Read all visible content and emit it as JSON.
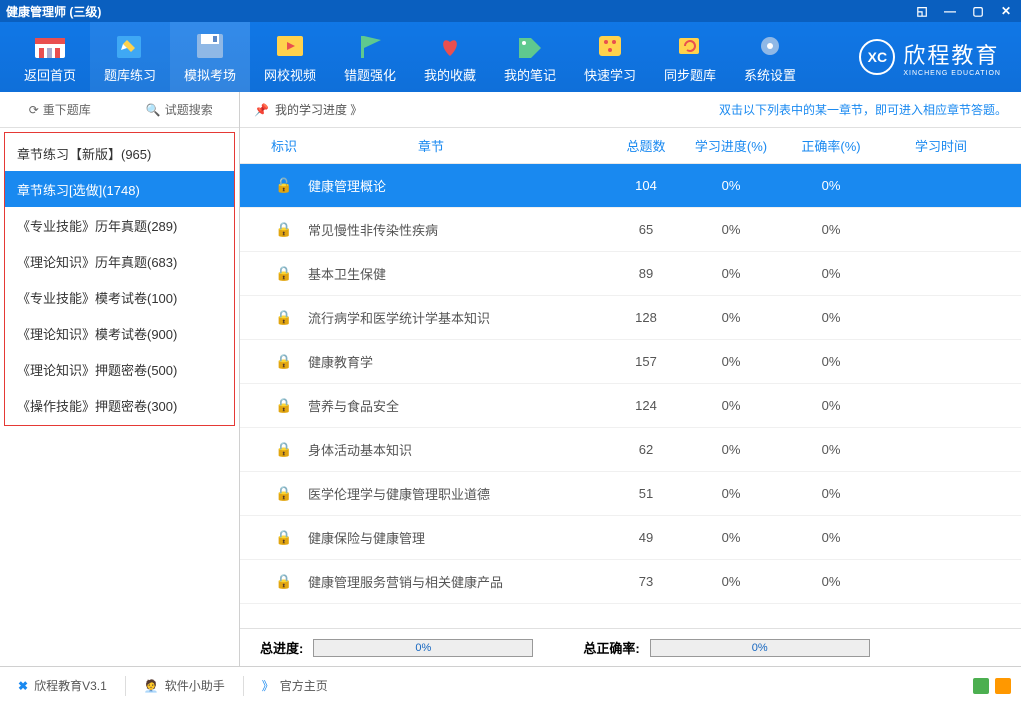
{
  "window": {
    "title": "健康管理师 (三级)"
  },
  "toolbar": [
    {
      "label": "返回首页"
    },
    {
      "label": "题库练习"
    },
    {
      "label": "模拟考场"
    },
    {
      "label": "网校视频"
    },
    {
      "label": "错题强化"
    },
    {
      "label": "我的收藏"
    },
    {
      "label": "我的笔记"
    },
    {
      "label": "快速学习"
    },
    {
      "label": "同步题库"
    },
    {
      "label": "系统设置"
    }
  ],
  "brand": {
    "abbr": "XC",
    "name": "欣程教育",
    "sub": "XINCHENG EDUCATION"
  },
  "sidebar": {
    "refresh": "重下题库",
    "search": "试题搜索",
    "items": [
      "章节练习【新版】(965)",
      "章节练习[选做](1748)",
      "《专业技能》历年真题(289)",
      "《理论知识》历年真题(683)",
      "《专业技能》模考试卷(100)",
      "《理论知识》模考试卷(900)",
      "《理论知识》押题密卷(500)",
      "《操作技能》押题密卷(300)"
    ]
  },
  "hintbar": {
    "left": "我的学习进度 》",
    "right": "双击以下列表中的某一章节，即可进入相应章节答题。"
  },
  "columns": {
    "flag": "标识",
    "chapter": "章节",
    "total": "总题数",
    "progress": "学习进度(%)",
    "accuracy": "正确率(%)",
    "time": "学习时间"
  },
  "rows": [
    {
      "title": "健康管理概论",
      "total": "104",
      "progress": "0%",
      "accuracy": "0%"
    },
    {
      "title": "常见慢性非传染性疾病",
      "total": "65",
      "progress": "0%",
      "accuracy": "0%"
    },
    {
      "title": "基本卫生保健",
      "total": "89",
      "progress": "0%",
      "accuracy": "0%"
    },
    {
      "title": "流行病学和医学统计学基本知识",
      "total": "128",
      "progress": "0%",
      "accuracy": "0%"
    },
    {
      "title": "健康教育学",
      "total": "157",
      "progress": "0%",
      "accuracy": "0%"
    },
    {
      "title": "营养与食品安全",
      "total": "124",
      "progress": "0%",
      "accuracy": "0%"
    },
    {
      "title": "身体活动基本知识",
      "total": "62",
      "progress": "0%",
      "accuracy": "0%"
    },
    {
      "title": "医学伦理学与健康管理职业道德",
      "total": "51",
      "progress": "0%",
      "accuracy": "0%"
    },
    {
      "title": "健康保险与健康管理",
      "total": "49",
      "progress": "0%",
      "accuracy": "0%"
    },
    {
      "title": "健康管理服务营销与相关健康产品",
      "total": "73",
      "progress": "0%",
      "accuracy": "0%"
    }
  ],
  "summary": {
    "totalProgressLabel": "总进度:",
    "totalProgressVal": "0%",
    "totalAccuracyLabel": "总正确率:",
    "totalAccuracyVal": "0%"
  },
  "status": {
    "app": "欣程教育V3.1",
    "helper": "软件小助手",
    "homepage": "官方主页",
    "chev": "》"
  }
}
